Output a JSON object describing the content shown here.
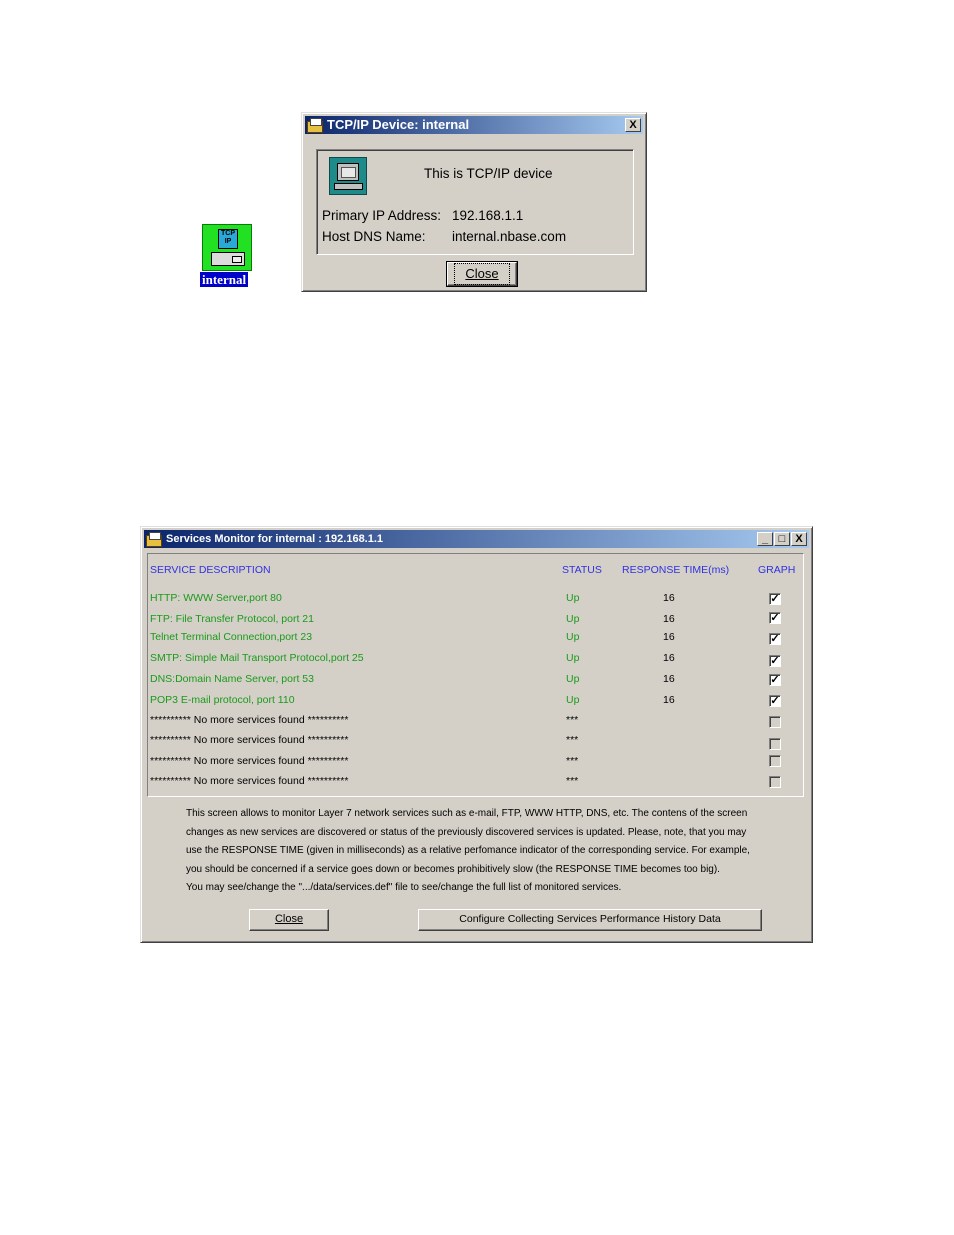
{
  "desktop_icon": {
    "label": "internal",
    "icon_text": "TCP IP"
  },
  "device_dialog": {
    "title": "TCP/IP Device: internal",
    "close_x": "X",
    "heading": "This is TCP/IP device",
    "ip_label": "Primary IP Address:",
    "ip_value": "192.168.1.1",
    "dns_label": "Host DNS Name:",
    "dns_value": "internal.nbase.com",
    "close_button": "Close"
  },
  "services_monitor": {
    "title": "Services Monitor for internal : 192.168.1.1",
    "window_buttons": {
      "minimize": "_",
      "maximize": "□",
      "close": "X"
    },
    "columns": {
      "description": "SERVICE DESCRIPTION",
      "status": "STATUS",
      "response_time": "RESPONSE TIME(ms)",
      "graph": "GRAPH"
    },
    "rows": [
      {
        "description": "HTTP: WWW Server,port 80",
        "status": "Up",
        "response": "16",
        "graph": true
      },
      {
        "description": "FTP: File Transfer Protocol, port 21",
        "status": "Up",
        "response": "16",
        "graph": true
      },
      {
        "description": "Telnet Terminal Connection,port 23",
        "status": "Up",
        "response": "16",
        "graph": true
      },
      {
        "description": "SMTP: Simple Mail Transport Protocol,port 25",
        "status": "Up",
        "response": "16",
        "graph": true
      },
      {
        "description": "DNS:Domain Name Server, port 53",
        "status": "Up",
        "response": "16",
        "graph": true
      },
      {
        "description": "POP3 E-mail protocol, port 110",
        "status": "Up",
        "response": "16",
        "graph": true
      },
      {
        "description": "********** No more services found **********",
        "status": "***",
        "response": "",
        "graph": false
      },
      {
        "description": "********** No more services found **********",
        "status": "***",
        "response": "",
        "graph": false
      },
      {
        "description": "********** No more services found **********",
        "status": "***",
        "response": "",
        "graph": false
      },
      {
        "description": "********** No more services found **********",
        "status": "***",
        "response": "",
        "graph": false
      }
    ],
    "info_lines": [
      "This screen allows to monitor Layer 7 network services such as e-mail, FTP, WWW HTTP, DNS, etc. The contens of the screen",
      "changes as new services are discovered or status of the previously discovered services is updated. Please, note, that you may",
      "use the RESPONSE TIME (given in milliseconds) as a relative perfomance indicator of the corresponding service. For example,",
      "you should be concerned if a service goes down  or  becomes prohibitively slow (the RESPONSE TIME becomes too big).",
      "You may see/change the \".../data/services.def\" file to see/change the full list of monitored services."
    ],
    "close_button": "Close",
    "configure_button": "Configure Collecting Services Performance History Data"
  },
  "colors": {
    "title_start": "#0a246a",
    "title_end": "#a6caf0",
    "service_text": "#1a9a1a",
    "header_text": "#3030e0"
  }
}
